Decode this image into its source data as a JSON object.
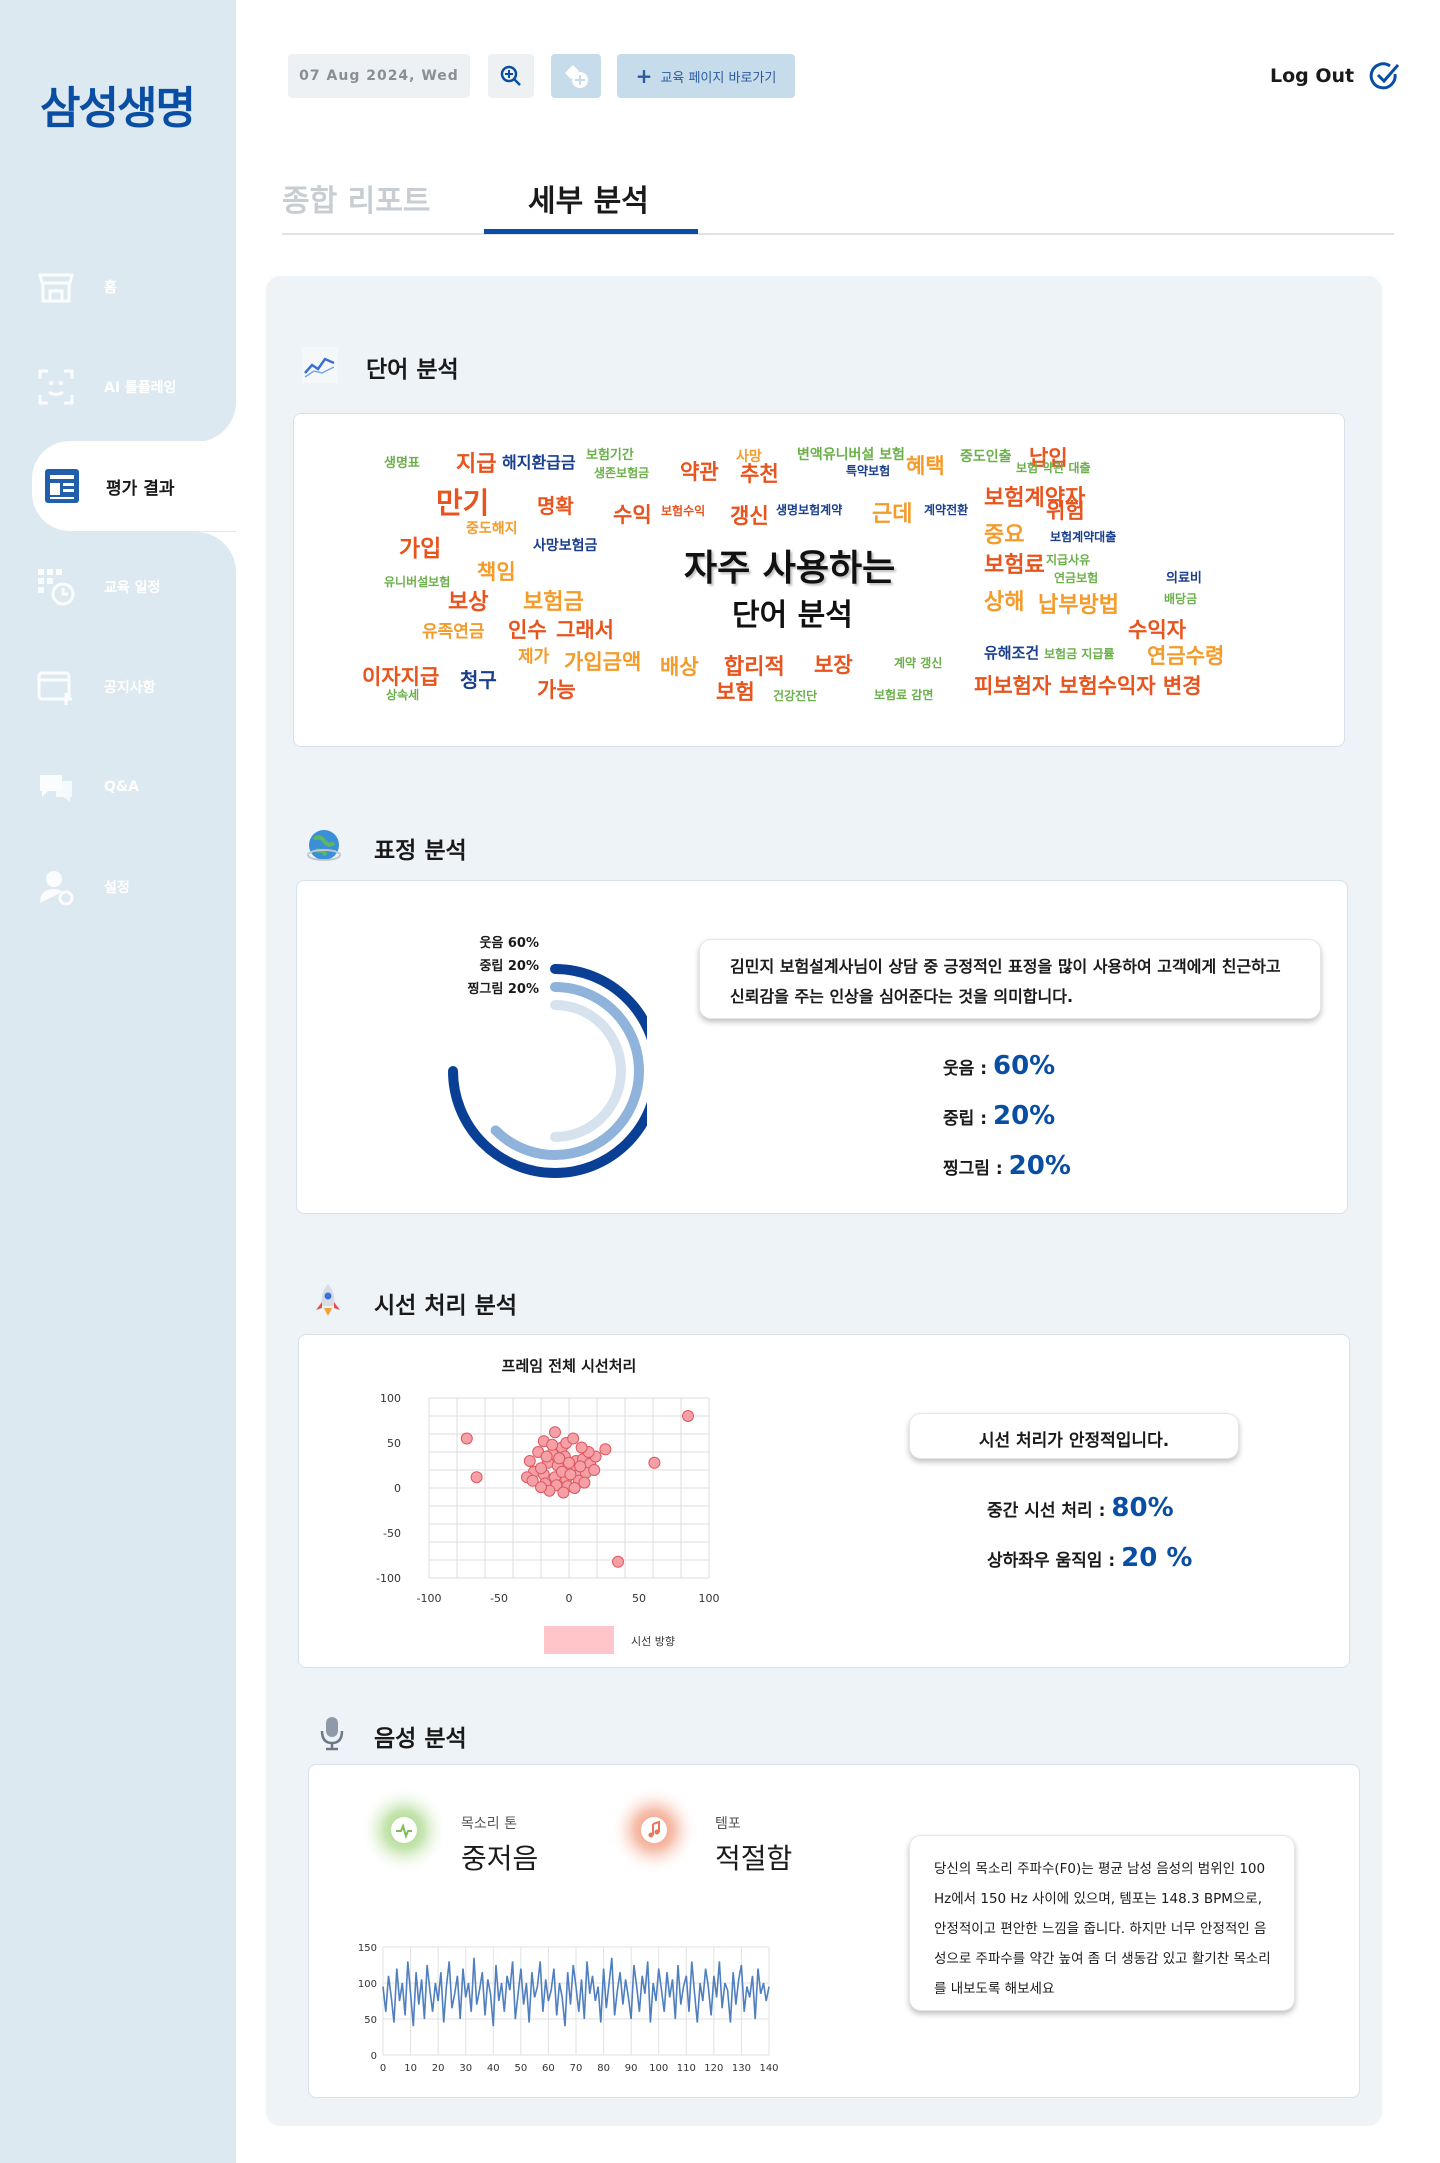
{
  "brand": {
    "logo": "삼성생명"
  },
  "sidebar": {
    "items": [
      {
        "label": "홈",
        "icon": "store-icon"
      },
      {
        "label": "AI 롤플레잉",
        "icon": "face-scan-icon"
      },
      {
        "label": "평가 결과",
        "icon": "report-icon"
      },
      {
        "label": "교육 일정",
        "icon": "calendar-clock-icon"
      },
      {
        "label": "공지사항",
        "icon": "notice-icon"
      },
      {
        "label": "Q&A",
        "icon": "chat-icon"
      },
      {
        "label": "설정",
        "icon": "user-settings-icon"
      }
    ]
  },
  "header": {
    "date": "07 Aug 2024, Wed",
    "edu_link": "교육 페이지 바로가기",
    "logout": "Log Out"
  },
  "tabs": [
    {
      "label": "종합 리포트",
      "active": false
    },
    {
      "label": "세부 분석",
      "active": true
    }
  ],
  "word_analysis": {
    "title": "단어 분석",
    "center_line1": "자주 사용하는",
    "center_line2": "단어 분석",
    "words": [
      "생명표",
      "지급",
      "해지환급금",
      "보험기간",
      "생존보험금",
      "약관",
      "사망",
      "추천",
      "변액유니버설 보험",
      "특약보험",
      "혜택",
      "중도인출",
      "납입",
      "보험 약관 대출",
      "만기",
      "명확",
      "중도해지",
      "수익",
      "보험수익",
      "갱신",
      "생명보험계약",
      "근데",
      "계약전환",
      "보험계약자",
      "위험",
      "가입",
      "사망보험금",
      "중요",
      "보험계약대출",
      "책임",
      "보험료",
      "지급사유",
      "유니버설보험",
      "연금보험",
      "의료비",
      "보상",
      "보험금",
      "상해",
      "납부방법",
      "배당금",
      "유족연금",
      "인수",
      "그래서",
      "수익자",
      "제가",
      "가입금액",
      "유해조건",
      "보험금 지급률",
      "연금수령",
      "이자지급",
      "청구",
      "배상",
      "합리적",
      "보장",
      "계약 갱신",
      "상속세",
      "가능",
      "보험",
      "건강진단",
      "보험료 감면",
      "피보험자",
      "보험수익자 변경"
    ]
  },
  "emotion": {
    "title": "표정 분석",
    "legend": [
      "웃음 60%",
      "중립 20%",
      "찡그림 20%"
    ],
    "comment": "김민지 보험설계사님이 상담 중 긍정적인 표정을 많이 사용하여 고객에게 친근하고 신뢰감을 주는 인상을 심어준다는 것을 의미합니다.",
    "stats": [
      {
        "label": "웃음 :",
        "value": "60%"
      },
      {
        "label": "중립 :",
        "value": "20%"
      },
      {
        "label": "찡그림 :",
        "value": "20%"
      }
    ],
    "colors": [
      "#0a3f96",
      "#8fb3db",
      "#d6e3ef"
    ],
    "percents": [
      60,
      20,
      20
    ]
  },
  "gaze": {
    "title": "시선 처리 분석",
    "chart_title": "프레임 전체 시선처리",
    "comment": "시선 처리가 안정적입니다.",
    "stats": [
      {
        "label": "중간 시선 처리 :",
        "value": "80%"
      },
      {
        "label": "상하좌우 움직임 :",
        "value": "20 %"
      }
    ]
  },
  "voice": {
    "title": "음성 분석",
    "tone_label": "목소리 톤",
    "tone_value": "중저음",
    "tempo_label": "템포",
    "tempo_value": "적절함",
    "comment": "당신의 목소리 주파수(F0)는 평균 남성 음성의 범위인 100 Hz에서 150 Hz 사이에 있으며, 템포는 148.3 BPM으로, 안정적이고 편안한 느낌을 줍니다. 하지만 너무 안정적인 음성으로 주파수를 약간 높여 좀 더 생동감 있고 활기찬 목소리를 내보도록 해보세요"
  },
  "chart_data": [
    {
      "type": "pie",
      "categories": [
        "웃음",
        "중립",
        "찡그림"
      ],
      "values": [
        60,
        20,
        20
      ]
    },
    {
      "type": "scatter",
      "title": "프레임 전체 시선처리",
      "xlim": [
        -100,
        100
      ],
      "ylim": [
        -100,
        100
      ],
      "xticks": [
        -100,
        -50,
        0,
        50,
        100
      ],
      "yticks": [
        100,
        50,
        0,
        -50,
        -100
      ],
      "series": [
        {
          "name": "시선 방향",
          "points": [
            [
              -73,
              55
            ],
            [
              -66,
              12
            ],
            [
              85,
              80
            ],
            [
              61,
              28
            ],
            [
              35,
              -82
            ],
            [
              26,
              43
            ],
            [
              -18,
              52
            ],
            [
              -10,
              62
            ],
            [
              -5,
              45
            ],
            [
              -22,
              40
            ],
            [
              -12,
              38
            ],
            [
              -3,
              35
            ],
            [
              5,
              30
            ],
            [
              -15,
              28
            ],
            [
              -8,
              25
            ],
            [
              2,
              22
            ],
            [
              10,
              32
            ],
            [
              15,
              27
            ],
            [
              19,
              35
            ],
            [
              -25,
              18
            ],
            [
              -18,
              15
            ],
            [
              -10,
              12
            ],
            [
              -2,
              10
            ],
            [
              6,
              14
            ],
            [
              12,
              17
            ],
            [
              -28,
              30
            ],
            [
              -20,
              22
            ],
            [
              -5,
              18
            ],
            [
              0,
              28
            ],
            [
              8,
              24
            ],
            [
              14,
              40
            ],
            [
              -30,
              12
            ],
            [
              -17,
              5
            ],
            [
              -9,
              3
            ],
            [
              -1,
              2
            ],
            [
              7,
              8
            ],
            [
              11,
              6
            ],
            [
              -14,
              -3
            ],
            [
              -4,
              -5
            ],
            [
              -20,
              1
            ],
            [
              4,
              0
            ],
            [
              -12,
              48
            ],
            [
              -2,
              50
            ],
            [
              3,
              55
            ],
            [
              -7,
              33
            ],
            [
              18,
              20
            ],
            [
              -26,
              8
            ],
            [
              9,
              45
            ],
            [
              -16,
              35
            ],
            [
              1,
              15
            ]
          ]
        }
      ]
    },
    {
      "type": "line",
      "xlim": [
        0,
        140
      ],
      "ylim": [
        0,
        150
      ],
      "xticks": [
        0,
        10,
        20,
        30,
        40,
        50,
        60,
        70,
        80,
        90,
        100,
        110,
        120,
        130,
        140
      ],
      "yticks": [
        150,
        100,
        50,
        0
      ],
      "series": [
        {
          "values": [
            95,
            60,
            110,
            80,
            45,
            120,
            75,
            100,
            55,
            130,
            85,
            40,
            115,
            70,
            105,
            50,
            125,
            90,
            60,
            100,
            75,
            115,
            45,
            95,
            130,
            65,
            85,
            110,
            50,
            120,
            80,
            100,
            60,
            135,
            70,
            90,
            115,
            55,
            105,
            85,
            40,
            125,
            75,
            100,
            60,
            110,
            90,
            130,
            50,
            85,
            120,
            70,
            100,
            45,
            115,
            80,
            95,
            130,
            60,
            105,
            75,
            90,
            120,
            55,
            100,
            80,
            40,
            115,
            70,
            125,
            95,
            60,
            105,
            50,
            130,
            85,
            110,
            75,
            95,
            45,
            120,
            65,
            100,
            135,
            55,
            90,
            115,
            70,
            105,
            80,
            50,
            125,
            95,
            60,
            110,
            85,
            130,
            45,
            100,
            75,
            120,
            90,
            60,
            115,
            80,
            105,
            50,
            125,
            70,
            95,
            110,
            60,
            130,
            85,
            45,
            100,
            75,
            120,
            95,
            55,
            110,
            80,
            130,
            65,
            100,
            90,
            45,
            115,
            70,
            105,
            125,
            60,
            95,
            80,
            110,
            50,
            120,
            85,
            100,
            75,
            95
          ]
        }
      ]
    }
  ]
}
